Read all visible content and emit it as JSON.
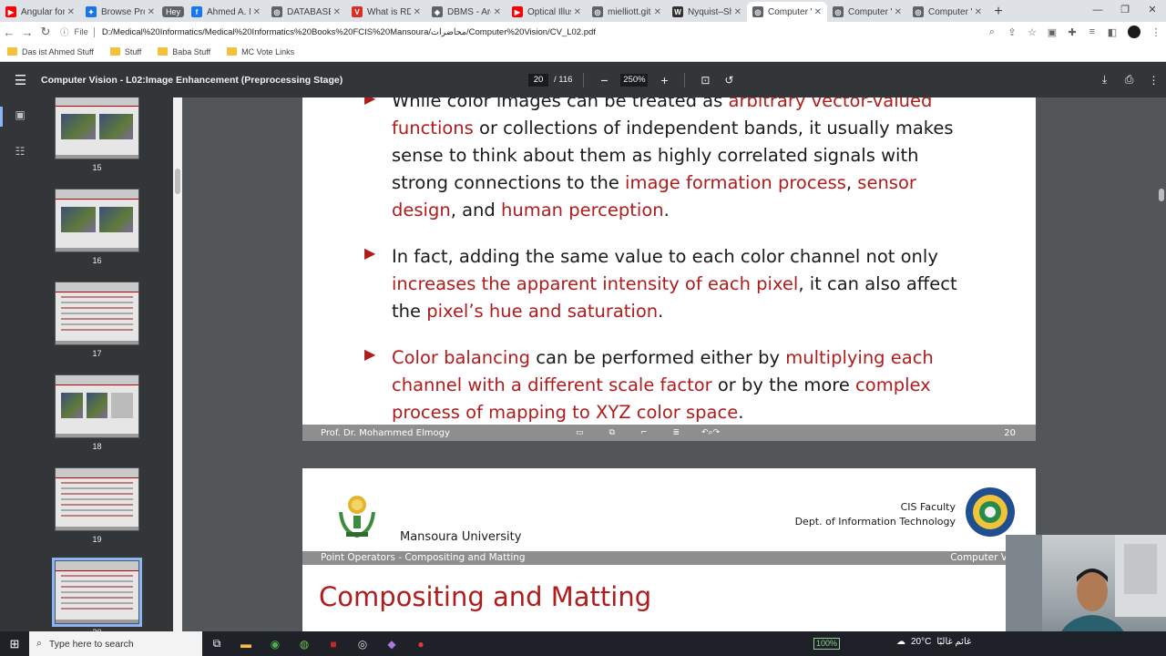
{
  "browser": {
    "tabs": [
      {
        "title": "Angular for Be",
        "color": "#ff0000",
        "glyph": "▶"
      },
      {
        "title": "Browse Projec",
        "color": "#1a73e8",
        "glyph": "✦"
      },
      {
        "title": "Hey",
        "hey": true
      },
      {
        "title": "Ahmed A. M",
        "color": "#1877f2",
        "glyph": "f"
      },
      {
        "title": "DATABASE M",
        "color": "#5f6368",
        "glyph": "◎"
      },
      {
        "title": "What is RDB",
        "color": "#d93025",
        "glyph": "V"
      },
      {
        "title": "DBMS - Arch",
        "color": "#5f6368",
        "glyph": "◈"
      },
      {
        "title": "Optical Illusi",
        "color": "#ff0000",
        "glyph": "▶"
      },
      {
        "title": "mielliott.githu",
        "color": "#5f6368",
        "glyph": "◎"
      },
      {
        "title": "Nyquist–Sha",
        "color": "#333333",
        "glyph": "W"
      },
      {
        "title": "Computer Vi",
        "color": "#5f6368",
        "glyph": "◎",
        "active": true
      },
      {
        "title": "Computer Vi",
        "color": "#5f6368",
        "glyph": "◎"
      },
      {
        "title": "Computer Vi",
        "color": "#5f6368",
        "glyph": "◎"
      }
    ],
    "address": "D:/Medical%20Informatics/Medical%20Informatics%20Books%20FCIS%20Mansoura/محاضرات/Computer%20Vision/CV_L02.pdf",
    "address_label": "File",
    "bookmarks": [
      "Das ist Ahmed Stuff",
      "Stuff",
      "Baba Stuff",
      "MC Vote Links"
    ]
  },
  "pdf": {
    "title": "Computer Vision - L02:Image Enhancement (Preprocessing Stage)",
    "page": "20",
    "page_count": "/ 116",
    "zoom": "250%",
    "thumbnails": [
      {
        "num": "15",
        "kind": "images"
      },
      {
        "num": "16",
        "kind": "images"
      },
      {
        "num": "17",
        "kind": "text"
      },
      {
        "num": "18",
        "kind": "mixed"
      },
      {
        "num": "19",
        "kind": "text"
      },
      {
        "num": "20",
        "kind": "text",
        "selected": true
      }
    ]
  },
  "slide20": {
    "b1_line1_a": "While color images can be treated as ",
    "b1_line1_b": "arbitrary vector-valued",
    "b1_line2_a": "functions",
    "b1_line2_b": " or collections of independent bands, it usually makes",
    "b1_line3": "sense to think about them as highly correlated signals with",
    "b1_line4_a": "strong connections to the ",
    "b1_line4_b": "image formation process",
    "b1_line4_c": ", ",
    "b1_line4_d": "sensor",
    "b1_line5_a": "design",
    "b1_line5_b": ", and ",
    "b1_line5_c": "human perception",
    "b1_line5_d": ".",
    "b2_line1": "In fact, adding the same value to each color channel not only",
    "b2_line2_a": "increases the apparent intensity of each pixel",
    "b2_line2_b": ", it can also affect",
    "b2_line3_a": "the ",
    "b2_line3_b": "pixel’s hue and saturation",
    "b2_line3_c": ".",
    "b3_line1_a": "Color balancing",
    "b3_line1_b": " can be performed either by ",
    "b3_line1_c": "multiplying each",
    "b3_line2_a": "channel with a different scale factor",
    "b3_line2_b": " or by the more ",
    "b3_line2_c": "complex",
    "b3_line3_a": "process of mapping to XYZ color space",
    "b3_line3_b": ".",
    "footer_author": "Prof. Dr. Mohammed Elmogy",
    "footer_page": "20"
  },
  "slide21": {
    "university": "Mansoura University",
    "faculty": "CIS Faculty",
    "dept": "Dept. of Information Technology",
    "band_left": "Point Operators - Compositing and Matting",
    "band_right": "Computer Visi",
    "title": "Compositing and Matting"
  },
  "taskbar": {
    "search_placeholder": "Type here to search",
    "battery": "100%",
    "temp": "20°C",
    "weather": "غائم غالبًا"
  },
  "colors": {
    "accent_red": "#b01c1c",
    "pdf_dark": "#323639"
  }
}
